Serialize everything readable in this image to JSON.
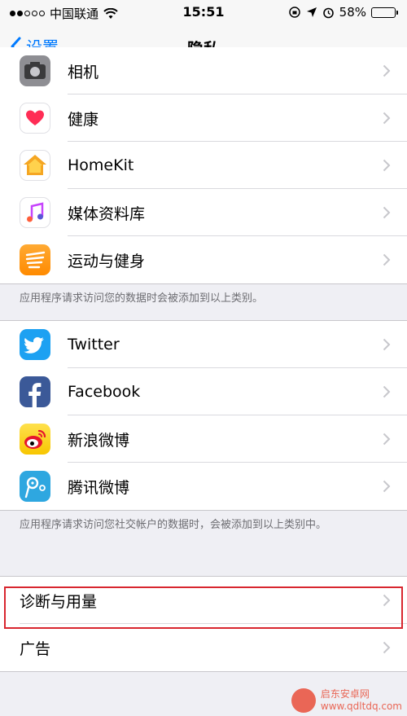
{
  "status_bar": {
    "carrier": "中国联通",
    "time": "15:51",
    "battery": "58%",
    "battery_level": 0.58
  },
  "nav": {
    "back_label": "设置",
    "title": "隐私"
  },
  "groups": [
    {
      "rows": [
        {
          "label": "相机",
          "icon": "camera-icon"
        },
        {
          "label": "健康",
          "icon": "health-icon"
        },
        {
          "label": "HomeKit",
          "icon": "homekit-icon"
        },
        {
          "label": "媒体资料库",
          "icon": "music-icon"
        },
        {
          "label": "运动与健身",
          "icon": "motion-icon"
        }
      ],
      "footer": "应用程序请求访问您的数据时会被添加到以上类别。"
    },
    {
      "rows": [
        {
          "label": "Twitter",
          "icon": "twitter-icon"
        },
        {
          "label": "Facebook",
          "icon": "facebook-icon"
        },
        {
          "label": "新浪微博",
          "icon": "weibo-icon"
        },
        {
          "label": "腾讯微博",
          "icon": "tencent-weibo-icon"
        }
      ],
      "footer": "应用程序请求访问您社交帐户的数据时，会被添加到以上类别中。"
    },
    {
      "rows": [
        {
          "label": "诊断与用量"
        },
        {
          "label": "广告"
        }
      ]
    }
  ],
  "colors": {
    "ios_blue": "#007aff",
    "highlight_red": "#d8262f",
    "twitter": "#1da1f2",
    "facebook": "#3b5998",
    "weibo": "#f7c600",
    "tencent": "#2ea7e0"
  },
  "watermark": {
    "name": "启东安卓网",
    "url": "www.qdltdq.com"
  }
}
